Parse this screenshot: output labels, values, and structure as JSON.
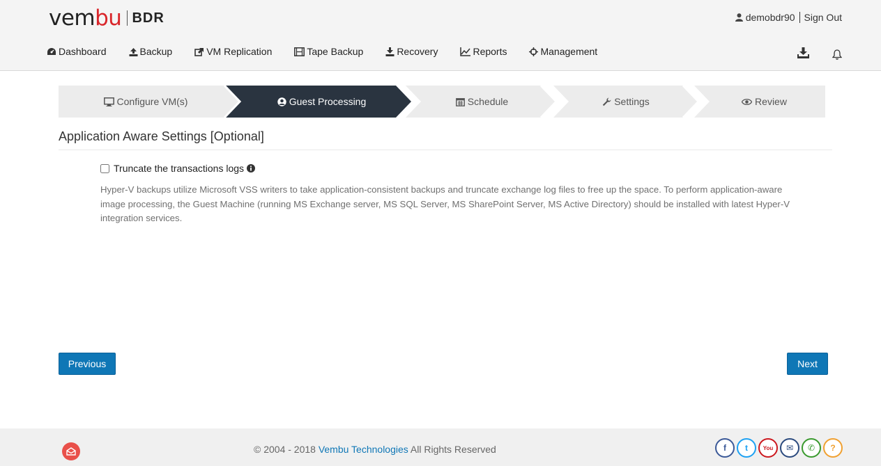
{
  "brand": {
    "logo_text_a": "vem",
    "logo_text_b": "bu",
    "product": "BDR",
    "accent_color": "#d9252a"
  },
  "user": {
    "name": "demobdr90",
    "sign_out": "Sign Out"
  },
  "nav": {
    "items": [
      {
        "label": "Dashboard",
        "icon": "dashboard-icon"
      },
      {
        "label": "Backup",
        "icon": "upload-icon"
      },
      {
        "label": "VM Replication",
        "icon": "share-icon"
      },
      {
        "label": "Tape Backup",
        "icon": "film-icon"
      },
      {
        "label": "Recovery",
        "icon": "download-icon"
      },
      {
        "label": "Reports",
        "icon": "line-chart-icon"
      },
      {
        "label": "Management",
        "icon": "crosshair-icon"
      }
    ],
    "right_icons": [
      "download-tray-icon",
      "bell-icon"
    ]
  },
  "wizard": {
    "active_color": "#2a3440",
    "inactive_color": "#ececec",
    "steps": [
      {
        "label": "Configure VM(s)",
        "icon": "monitor-icon",
        "active": false
      },
      {
        "label": "Guest Processing",
        "icon": "user-circle-icon",
        "active": true
      },
      {
        "label": "Schedule",
        "icon": "calendar-icon",
        "active": false
      },
      {
        "label": "Settings",
        "icon": "wrench-icon",
        "active": false
      },
      {
        "label": "Review",
        "icon": "eye-icon",
        "active": false
      }
    ]
  },
  "content": {
    "section_title": "Application Aware Settings [Optional]",
    "checkbox_label": "Truncate the transactions logs",
    "checkbox_checked": false,
    "description": "Hyper-V backups utilize Microsoft VSS writers to take application-consistent backups and truncate exchange log files to free up the space. To perform application-aware image processing, the Guest Machine (running MS Exchange server, MS SQL Server, MS SharePoint Server, MS Active Directory) should be installed with latest Hyper-V integration services."
  },
  "buttons": {
    "previous": "Previous",
    "next": "Next",
    "color": "#0f77b6"
  },
  "footer": {
    "copyright_prefix": "© 2004 - 2018",
    "company": "Vembu Technologies",
    "rights": "All Rights Reserved",
    "social": [
      {
        "name": "facebook-icon",
        "glyph": "f",
        "color": "#3b5998"
      },
      {
        "name": "twitter-icon",
        "glyph": "t",
        "color": "#1da1f2"
      },
      {
        "name": "youtube-icon",
        "glyph": "You",
        "color": "#cc181e"
      },
      {
        "name": "email-icon",
        "glyph": "✉",
        "color": "#2b4a7e"
      },
      {
        "name": "phone-icon",
        "glyph": "✆",
        "color": "#3a9a2e"
      },
      {
        "name": "help-icon",
        "glyph": "?",
        "color": "#f0a030"
      }
    ]
  }
}
